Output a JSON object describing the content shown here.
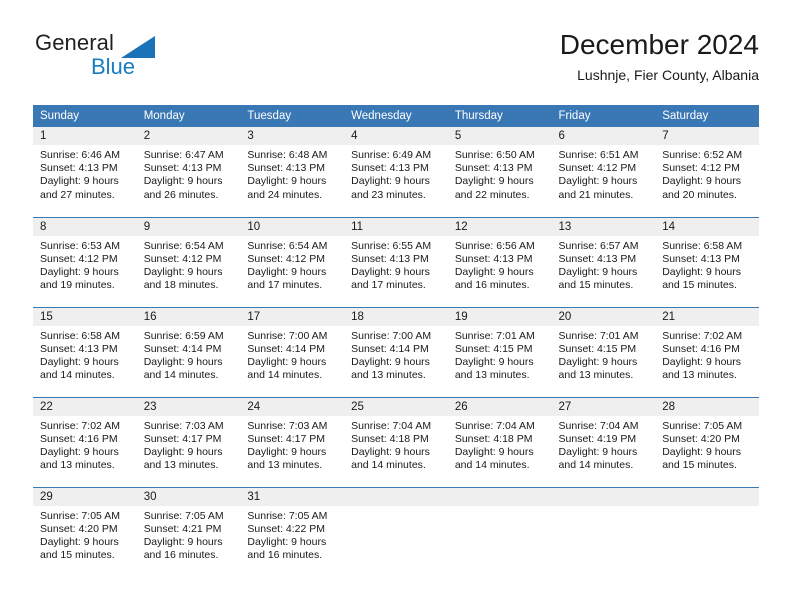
{
  "brand": {
    "name_part1": "General",
    "name_part2": "Blue",
    "logo_icon": "triangle-icon",
    "accent_color": "#1a7cc1"
  },
  "header": {
    "title": "December 2024",
    "subtitle": "Lushnje, Fier County, Albania"
  },
  "theme": {
    "header_bar_color": "#3a77b5",
    "daynum_band_color": "#efefef",
    "text_color": "#1a1a1a"
  },
  "weekday_headers": [
    "Sunday",
    "Monday",
    "Tuesday",
    "Wednesday",
    "Thursday",
    "Friday",
    "Saturday"
  ],
  "weeks": [
    [
      {
        "day": "1",
        "sunrise": "Sunrise: 6:46 AM",
        "sunset": "Sunset: 4:13 PM",
        "daylight_line1": "Daylight: 9 hours",
        "daylight_line2": "and 27 minutes."
      },
      {
        "day": "2",
        "sunrise": "Sunrise: 6:47 AM",
        "sunset": "Sunset: 4:13 PM",
        "daylight_line1": "Daylight: 9 hours",
        "daylight_line2": "and 26 minutes."
      },
      {
        "day": "3",
        "sunrise": "Sunrise: 6:48 AM",
        "sunset": "Sunset: 4:13 PM",
        "daylight_line1": "Daylight: 9 hours",
        "daylight_line2": "and 24 minutes."
      },
      {
        "day": "4",
        "sunrise": "Sunrise: 6:49 AM",
        "sunset": "Sunset: 4:13 PM",
        "daylight_line1": "Daylight: 9 hours",
        "daylight_line2": "and 23 minutes."
      },
      {
        "day": "5",
        "sunrise": "Sunrise: 6:50 AM",
        "sunset": "Sunset: 4:13 PM",
        "daylight_line1": "Daylight: 9 hours",
        "daylight_line2": "and 22 minutes."
      },
      {
        "day": "6",
        "sunrise": "Sunrise: 6:51 AM",
        "sunset": "Sunset: 4:12 PM",
        "daylight_line1": "Daylight: 9 hours",
        "daylight_line2": "and 21 minutes."
      },
      {
        "day": "7",
        "sunrise": "Sunrise: 6:52 AM",
        "sunset": "Sunset: 4:12 PM",
        "daylight_line1": "Daylight: 9 hours",
        "daylight_line2": "and 20 minutes."
      }
    ],
    [
      {
        "day": "8",
        "sunrise": "Sunrise: 6:53 AM",
        "sunset": "Sunset: 4:12 PM",
        "daylight_line1": "Daylight: 9 hours",
        "daylight_line2": "and 19 minutes."
      },
      {
        "day": "9",
        "sunrise": "Sunrise: 6:54 AM",
        "sunset": "Sunset: 4:12 PM",
        "daylight_line1": "Daylight: 9 hours",
        "daylight_line2": "and 18 minutes."
      },
      {
        "day": "10",
        "sunrise": "Sunrise: 6:54 AM",
        "sunset": "Sunset: 4:12 PM",
        "daylight_line1": "Daylight: 9 hours",
        "daylight_line2": "and 17 minutes."
      },
      {
        "day": "11",
        "sunrise": "Sunrise: 6:55 AM",
        "sunset": "Sunset: 4:13 PM",
        "daylight_line1": "Daylight: 9 hours",
        "daylight_line2": "and 17 minutes."
      },
      {
        "day": "12",
        "sunrise": "Sunrise: 6:56 AM",
        "sunset": "Sunset: 4:13 PM",
        "daylight_line1": "Daylight: 9 hours",
        "daylight_line2": "and 16 minutes."
      },
      {
        "day": "13",
        "sunrise": "Sunrise: 6:57 AM",
        "sunset": "Sunset: 4:13 PM",
        "daylight_line1": "Daylight: 9 hours",
        "daylight_line2": "and 15 minutes."
      },
      {
        "day": "14",
        "sunrise": "Sunrise: 6:58 AM",
        "sunset": "Sunset: 4:13 PM",
        "daylight_line1": "Daylight: 9 hours",
        "daylight_line2": "and 15 minutes."
      }
    ],
    [
      {
        "day": "15",
        "sunrise": "Sunrise: 6:58 AM",
        "sunset": "Sunset: 4:13 PM",
        "daylight_line1": "Daylight: 9 hours",
        "daylight_line2": "and 14 minutes."
      },
      {
        "day": "16",
        "sunrise": "Sunrise: 6:59 AM",
        "sunset": "Sunset: 4:14 PM",
        "daylight_line1": "Daylight: 9 hours",
        "daylight_line2": "and 14 minutes."
      },
      {
        "day": "17",
        "sunrise": "Sunrise: 7:00 AM",
        "sunset": "Sunset: 4:14 PM",
        "daylight_line1": "Daylight: 9 hours",
        "daylight_line2": "and 14 minutes."
      },
      {
        "day": "18",
        "sunrise": "Sunrise: 7:00 AM",
        "sunset": "Sunset: 4:14 PM",
        "daylight_line1": "Daylight: 9 hours",
        "daylight_line2": "and 13 minutes."
      },
      {
        "day": "19",
        "sunrise": "Sunrise: 7:01 AM",
        "sunset": "Sunset: 4:15 PM",
        "daylight_line1": "Daylight: 9 hours",
        "daylight_line2": "and 13 minutes."
      },
      {
        "day": "20",
        "sunrise": "Sunrise: 7:01 AM",
        "sunset": "Sunset: 4:15 PM",
        "daylight_line1": "Daylight: 9 hours",
        "daylight_line2": "and 13 minutes."
      },
      {
        "day": "21",
        "sunrise": "Sunrise: 7:02 AM",
        "sunset": "Sunset: 4:16 PM",
        "daylight_line1": "Daylight: 9 hours",
        "daylight_line2": "and 13 minutes."
      }
    ],
    [
      {
        "day": "22",
        "sunrise": "Sunrise: 7:02 AM",
        "sunset": "Sunset: 4:16 PM",
        "daylight_line1": "Daylight: 9 hours",
        "daylight_line2": "and 13 minutes."
      },
      {
        "day": "23",
        "sunrise": "Sunrise: 7:03 AM",
        "sunset": "Sunset: 4:17 PM",
        "daylight_line1": "Daylight: 9 hours",
        "daylight_line2": "and 13 minutes."
      },
      {
        "day": "24",
        "sunrise": "Sunrise: 7:03 AM",
        "sunset": "Sunset: 4:17 PM",
        "daylight_line1": "Daylight: 9 hours",
        "daylight_line2": "and 13 minutes."
      },
      {
        "day": "25",
        "sunrise": "Sunrise: 7:04 AM",
        "sunset": "Sunset: 4:18 PM",
        "daylight_line1": "Daylight: 9 hours",
        "daylight_line2": "and 14 minutes."
      },
      {
        "day": "26",
        "sunrise": "Sunrise: 7:04 AM",
        "sunset": "Sunset: 4:18 PM",
        "daylight_line1": "Daylight: 9 hours",
        "daylight_line2": "and 14 minutes."
      },
      {
        "day": "27",
        "sunrise": "Sunrise: 7:04 AM",
        "sunset": "Sunset: 4:19 PM",
        "daylight_line1": "Daylight: 9 hours",
        "daylight_line2": "and 14 minutes."
      },
      {
        "day": "28",
        "sunrise": "Sunrise: 7:05 AM",
        "sunset": "Sunset: 4:20 PM",
        "daylight_line1": "Daylight: 9 hours",
        "daylight_line2": "and 15 minutes."
      }
    ],
    [
      {
        "day": "29",
        "sunrise": "Sunrise: 7:05 AM",
        "sunset": "Sunset: 4:20 PM",
        "daylight_line1": "Daylight: 9 hours",
        "daylight_line2": "and 15 minutes."
      },
      {
        "day": "30",
        "sunrise": "Sunrise: 7:05 AM",
        "sunset": "Sunset: 4:21 PM",
        "daylight_line1": "Daylight: 9 hours",
        "daylight_line2": "and 16 minutes."
      },
      {
        "day": "31",
        "sunrise": "Sunrise: 7:05 AM",
        "sunset": "Sunset: 4:22 PM",
        "daylight_line1": "Daylight: 9 hours",
        "daylight_line2": "and 16 minutes."
      },
      {
        "day": "",
        "sunrise": "",
        "sunset": "",
        "daylight_line1": "",
        "daylight_line2": ""
      },
      {
        "day": "",
        "sunrise": "",
        "sunset": "",
        "daylight_line1": "",
        "daylight_line2": ""
      },
      {
        "day": "",
        "sunrise": "",
        "sunset": "",
        "daylight_line1": "",
        "daylight_line2": ""
      },
      {
        "day": "",
        "sunrise": "",
        "sunset": "",
        "daylight_line1": "",
        "daylight_line2": ""
      }
    ]
  ]
}
